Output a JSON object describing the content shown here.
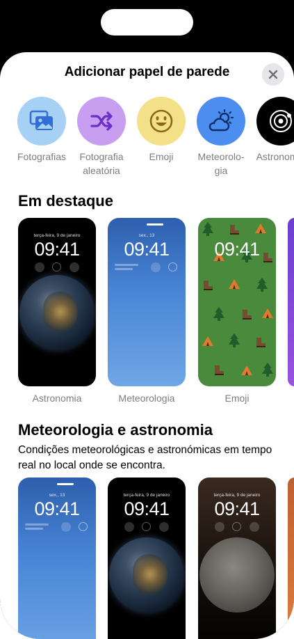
{
  "sheet": {
    "title": "Adicionar papel de parede",
    "close_icon": "close-icon"
  },
  "categories": [
    {
      "label": "Fotografias",
      "icon": "photos-icon",
      "color": "#a7d0f5"
    },
    {
      "label": "Fotografia\naleatória",
      "icon": "shuffle-icon",
      "color": "#c89ef0"
    },
    {
      "label": "Emoji",
      "icon": "smiley-icon",
      "color": "#f5e08a"
    },
    {
      "label": "Meteorolo-\ngia",
      "icon": "weather-icon",
      "color": "#4b8ef0"
    },
    {
      "label": "Astronomia",
      "icon": "orbit-icon",
      "color": "#000000"
    }
  ],
  "featured": {
    "title": "Em destaque",
    "cards": [
      {
        "caption": "Astronomia",
        "date": "terça-feira, 9 de janeiro",
        "time": "09:41"
      },
      {
        "caption": "Meteorologia",
        "date": "sex., 13",
        "time": "09:41"
      },
      {
        "caption": "Emoji",
        "date": "",
        "time": "09:41"
      }
    ]
  },
  "weather_astro": {
    "title": "Meteorologia e astronomia",
    "description": "Condições meteorológicas e astronómicas em tempo real no local onde se encontra.",
    "cards": [
      {
        "date": "sex., 13",
        "time": "09:41"
      },
      {
        "date": "terça-feira, 9 de janeiro",
        "time": "09:41"
      },
      {
        "date": "terça-feira, 9 de janeiro",
        "time": "09:41"
      }
    ]
  }
}
